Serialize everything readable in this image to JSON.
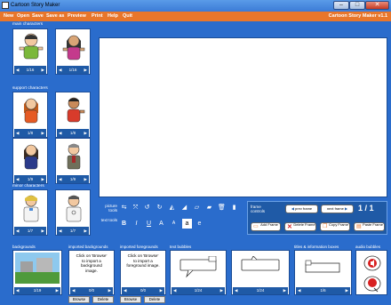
{
  "window": {
    "title": "Cartoon Story Maker"
  },
  "menu": {
    "items": [
      "New",
      "Open",
      "Save",
      "Save as",
      "Preview",
      "Print",
      "Help",
      "Quit"
    ],
    "brand": "Cartoon Story Maker v1.1"
  },
  "left": {
    "main_characters_label": "main characters",
    "support_characters_label": "support characters",
    "minor_characters_label": "minor characters",
    "pagers": {
      "main_1": "1/16",
      "main_2": "1/16",
      "support_1": "1/8",
      "support_2": "1/8",
      "support_3": "1/9",
      "support_4": "1/9",
      "minor_1": "1/7",
      "minor_2": "1/7"
    }
  },
  "tools": {
    "picture_tools_label": "picture tools",
    "text_tools_label": "text tools",
    "text_buttons": [
      "B",
      "I",
      "U",
      "A",
      "A",
      "a",
      "e"
    ]
  },
  "frame_controls": {
    "label": "frame controls",
    "prev_label": "prev frame",
    "next_label": "next frame",
    "counter": "1 / 1",
    "add_label": "Add Frame",
    "delete_label": "Delete Frame",
    "copy_label": "Copy Frame",
    "paste_label": "Paste Frame"
  },
  "bottom": {
    "backgrounds_label": "backgrounds",
    "imported_backgrounds_label": "imported backgrounds",
    "imported_foregrounds_label": "imported foregrounds",
    "text_bubbles_label": "text bubbles",
    "titles_label": "titles & information boxes",
    "audio_bubbles_label": "audio bubbles",
    "imported_bg_text": "Click on 'Browse' to import a background image.",
    "imported_fg_text": "Click on 'Browse' to import a foreground image.",
    "pagers": {
      "backgrounds": "1/19",
      "imported_bg": "0/0",
      "imported_fg": "0/0",
      "text_bubble_1": "1/24",
      "text_bubble_2": "1/24",
      "titles": "1/6"
    },
    "browse_label": "Browse",
    "delete_label": "Delete"
  },
  "colors": {
    "menubar": "#e8762b",
    "background": "#2a6ccc",
    "panel_dark": "#1f5aa6"
  }
}
